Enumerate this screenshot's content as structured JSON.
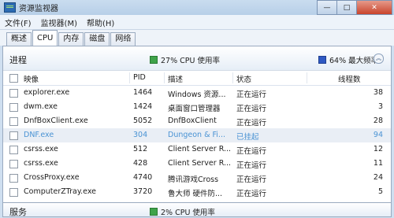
{
  "window": {
    "title": "资源监视器"
  },
  "menu": [
    "文件(F)",
    "监视器(M)",
    "帮助(H)"
  ],
  "tabs": [
    "概述",
    "CPU",
    "内存",
    "磁盘",
    "网络"
  ],
  "active_tab": "CPU",
  "processes": {
    "title": "进程",
    "cpu_usage": "27% CPU 使用率",
    "max_freq": "64% 最大频率",
    "columns": [
      "映像",
      "PID",
      "描述",
      "状态",
      "线程数"
    ],
    "rows": [
      {
        "image": "explorer.exe",
        "pid": "1464",
        "desc": "Windows 资源...",
        "status": "正在运行",
        "threads": "38",
        "suspended": false
      },
      {
        "image": "dwm.exe",
        "pid": "1424",
        "desc": "桌面窗口管理器",
        "status": "正在运行",
        "threads": "3",
        "suspended": false
      },
      {
        "image": "DnfBoxClient.exe",
        "pid": "5052",
        "desc": "DnfBoxClient",
        "status": "正在运行",
        "threads": "28",
        "suspended": false
      },
      {
        "image": "DNF.exe",
        "pid": "304",
        "desc": "Dungeon & Fi...",
        "status": "已挂起",
        "threads": "94",
        "suspended": true
      },
      {
        "image": "csrss.exe",
        "pid": "512",
        "desc": "Client Server R...",
        "status": "正在运行",
        "threads": "12",
        "suspended": false
      },
      {
        "image": "csrss.exe",
        "pid": "428",
        "desc": "Client Server R...",
        "status": "正在运行",
        "threads": "11",
        "suspended": false
      },
      {
        "image": "CrossProxy.exe",
        "pid": "4740",
        "desc": "腾讯游戏Cross",
        "status": "正在运行",
        "threads": "24",
        "suspended": false
      },
      {
        "image": "ComputerZTray.exe",
        "pid": "3720",
        "desc": "鲁大师 硬件防...",
        "status": "正在运行",
        "threads": "5",
        "suspended": false
      }
    ]
  },
  "services": {
    "title": "服务",
    "cpu_usage": "2% CPU 使用率"
  },
  "colors": {
    "cpu_green": "#3fa34a",
    "freq_blue": "#2f59c3",
    "suspended_text": "#4a93d4"
  }
}
